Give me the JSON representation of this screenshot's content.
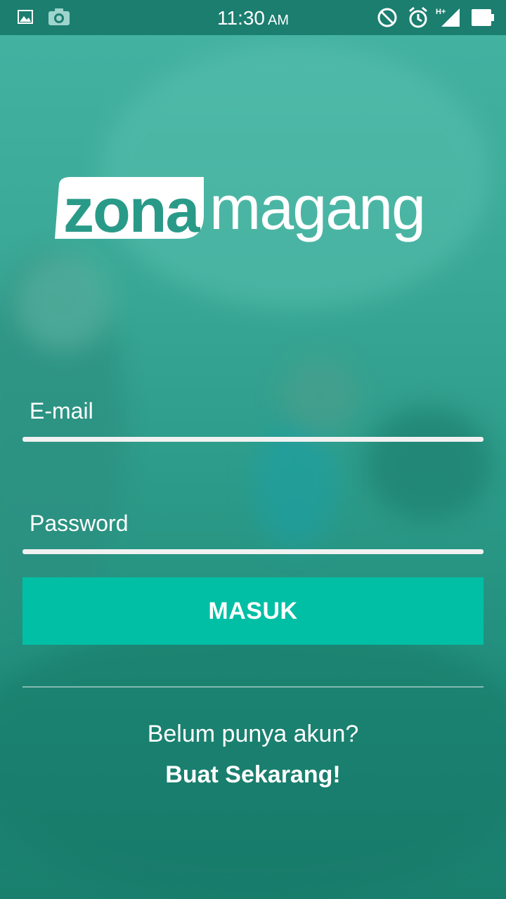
{
  "status_bar": {
    "time": "11:30",
    "ampm": "AM",
    "left_icons": [
      "image-icon",
      "camera-icon"
    ],
    "right_icons": [
      "do-not-disturb-icon",
      "alarm-icon",
      "signal-hplus-icon",
      "battery-icon"
    ],
    "network_label": "H+"
  },
  "logo": {
    "part1": "zona",
    "part2": "magang"
  },
  "form": {
    "email_placeholder": "E-mail",
    "password_placeholder": "Password",
    "login_label": "MASUK"
  },
  "footer": {
    "no_account_text": "Belum punya akun?",
    "signup_label": "Buat Sekarang!"
  },
  "colors": {
    "status_bar": "#1b7e6f",
    "background": "#3aa896",
    "button": "#00bfa5",
    "text": "#ffffff"
  }
}
